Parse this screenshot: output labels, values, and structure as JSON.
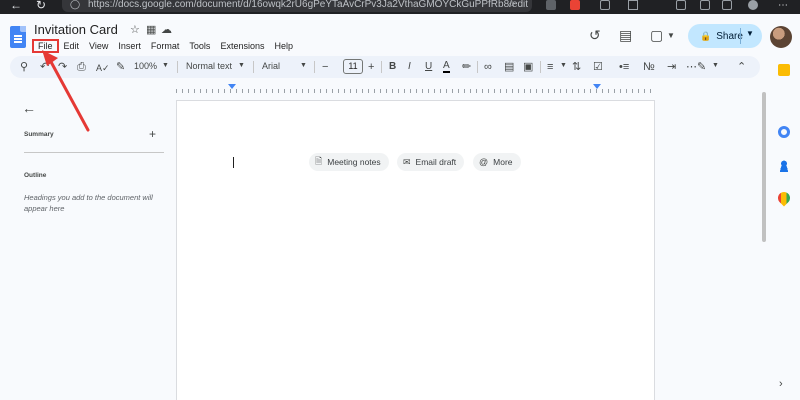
{
  "browser": {
    "url": "https://docs.google.com/document/d/16owqk2rU6gPeYTaAvCrPv3Ja2VthaGMOYCkGuPPfRb8/edit",
    "icons": [
      "back-icon",
      "refresh-icon",
      "lock-icon",
      "star-icon",
      "extension-icon",
      "profile-icon",
      "menu-icon"
    ]
  },
  "doc": {
    "title": "Invitation Card",
    "title_icons": [
      "star-icon",
      "move-to-folder-icon",
      "cloud-saved-icon"
    ]
  },
  "menu": {
    "items": [
      "File",
      "Edit",
      "View",
      "Insert",
      "Format",
      "Tools",
      "Extensions",
      "Help"
    ]
  },
  "header": {
    "share_label": "Share",
    "icons": [
      "version-history-icon",
      "comments-icon",
      "meet-icon"
    ]
  },
  "toolbar": {
    "zoom": "100%",
    "style": "Normal text",
    "font": "Arial",
    "font_size": "11",
    "icons": [
      "search-icon",
      "undo-icon",
      "redo-icon",
      "print-icon",
      "spellcheck-icon",
      "paint-format-icon",
      "decrease-size-icon",
      "increase-size-icon",
      "bold-icon",
      "italic-icon",
      "underline-icon",
      "text-color-icon",
      "highlight-icon",
      "link-icon",
      "comment-icon",
      "image-icon",
      "align-icon",
      "line-spacing-icon",
      "checklist-icon",
      "bullet-list-icon",
      "numbered-list-icon",
      "indent-icon",
      "clear-format-icon",
      "editing-mode-icon",
      "collapse-icon"
    ]
  },
  "outline": {
    "summary_label": "Summary",
    "outline_label": "Outline",
    "hint": "Headings you add to the document will appear here"
  },
  "chips": [
    {
      "label": "Meeting notes",
      "icon": "document-icon"
    },
    {
      "label": "Email draft",
      "icon": "email-icon"
    },
    {
      "label": "More",
      "icon": "at-sign-icon"
    }
  ],
  "side_panel": {
    "icons": [
      "keep-icon",
      "tasks-icon",
      "contacts-icon",
      "maps-icon"
    ]
  },
  "colors": {
    "accent": "#4285f4",
    "share_bg": "#c2e7ff",
    "annotation": "#e53935",
    "toolbar_bg": "#edf2fa"
  }
}
